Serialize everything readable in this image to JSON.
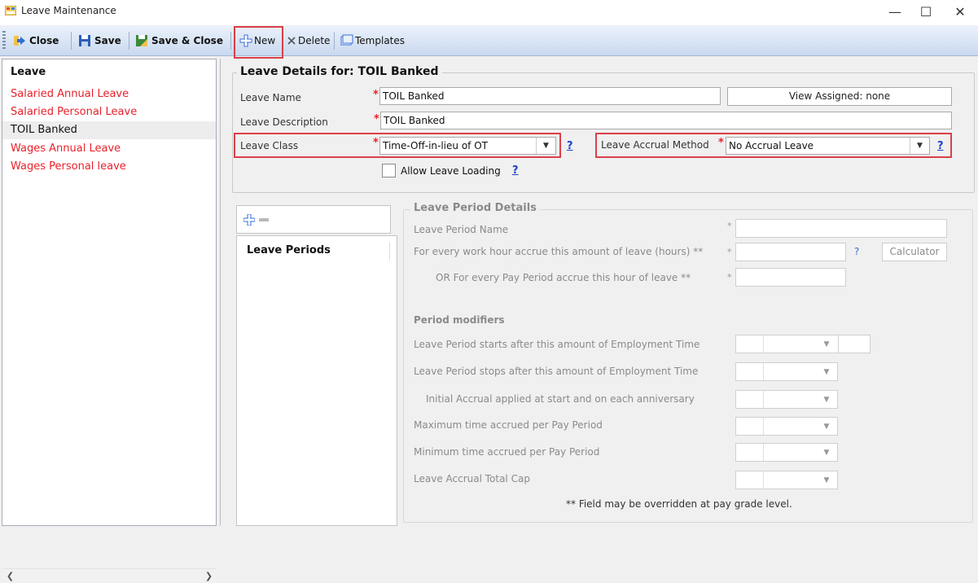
{
  "window": {
    "title": "Leave Maintenance",
    "min_icon": "minimize-icon",
    "max_icon": "maximize-icon",
    "close_icon": "close-icon"
  },
  "toolbar": {
    "close": "Close",
    "save": "Save",
    "save_close": "Save & Close",
    "new": "New",
    "delete": "Delete",
    "templates": "Templates"
  },
  "leave_list": {
    "header": "Leave",
    "items": [
      {
        "label": "Salaried Annual Leave",
        "selected": false
      },
      {
        "label": "Salaried Personal Leave",
        "selected": false
      },
      {
        "label": "TOIL Banked",
        "selected": true
      },
      {
        "label": "Wages Annual Leave",
        "selected": false
      },
      {
        "label": "Wages Personal leave",
        "selected": false
      }
    ]
  },
  "details": {
    "title": "Leave Details for: TOIL Banked",
    "leave_name_label": "Leave Name",
    "leave_name_value": "TOIL Banked",
    "view_assigned": "View Assigned: none",
    "leave_description_label": "Leave Description",
    "leave_description_value": "TOIL Banked",
    "leave_class_label": "Leave Class",
    "leave_class_value": "Time-Off-in-lieu of OT",
    "accrual_method_label": "Leave Accrual Method",
    "accrual_method_value": "No Accrual Leave",
    "allow_loading_label": "Allow Leave Loading",
    "allow_loading_checked": false,
    "help": "?",
    "required": "*"
  },
  "periods": {
    "header": "Leave Periods",
    "add_icon": "plus-icon",
    "remove_icon": "minus-icon"
  },
  "period_details": {
    "title": "Leave Period Details",
    "period_name_label": "Leave Period Name",
    "work_hour_label": "For every work hour accrue this amount of leave (hours)  **",
    "pay_period_label": "OR For every Pay Period accrue this hour of leave **",
    "help": "?",
    "calculator": "Calculator",
    "modifiers_title": "Period modifiers",
    "starts_after_label": "Leave Period starts after this amount of Employment Time",
    "stops_after_label": "Leave Period stops after this amount of Employment Time",
    "initial_accrual_label": "Initial Accrual applied at start and on each anniversary",
    "max_time_label": "Maximum time accrued per Pay Period",
    "min_time_label": "Minimum time accrued per Pay Period",
    "total_cap_label": "Leave Accrual Total Cap",
    "footnote": "** Field may be overridden at pay grade level."
  },
  "colors": {
    "accent_red": "#d9404a",
    "link_blue": "#1f3fcf",
    "leave_red": "#e8212b"
  }
}
